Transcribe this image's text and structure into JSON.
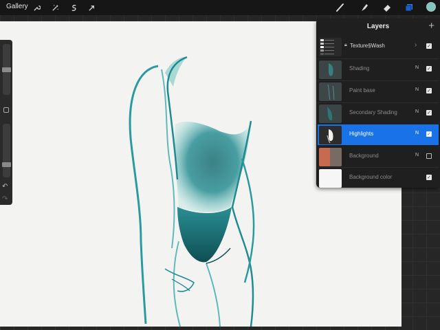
{
  "toolbar": {
    "gallery_label": "Gallery",
    "left_tools": [
      "wrench-icon",
      "magic-wand-icon",
      "selection-icon",
      "transform-arrow-icon"
    ],
    "right_tools": [
      "brush-icon",
      "smudge-icon",
      "eraser-icon",
      "layers-icon"
    ],
    "color": "#7ec8c0"
  },
  "layers_panel": {
    "title": "Layers",
    "add_label": "+",
    "layers": [
      {
        "name": "Texture§Wash",
        "type": "group",
        "locked": true,
        "visible": true
      },
      {
        "name": "Shading",
        "blend": "N",
        "visible": true
      },
      {
        "name": "Paint base",
        "blend": "N",
        "visible": true
      },
      {
        "name": "Secondary Shading",
        "blend": "N",
        "visible": true
      },
      {
        "name": "Highlights",
        "blend": "N",
        "visible": true,
        "selected": true
      },
      {
        "name": "Background",
        "blend": "N",
        "visible": false
      },
      {
        "name": "Background color",
        "visible": true
      }
    ]
  },
  "sidebar": {
    "undo_label": "↶",
    "redo_label": "↷"
  },
  "colors": {
    "accent": "#1a72e8",
    "ink": "#1f8a90",
    "ink_dark": "#0e5257"
  }
}
